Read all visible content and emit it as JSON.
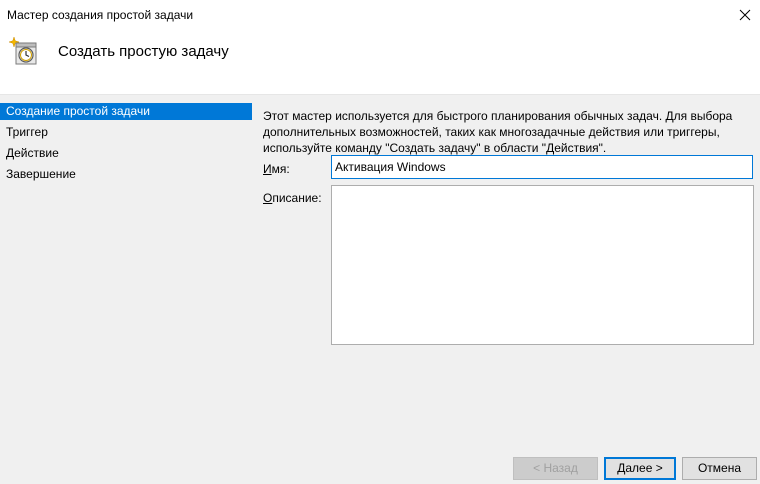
{
  "window": {
    "title": "Мастер создания простой задачи"
  },
  "header": {
    "title": "Создать простую задачу",
    "icon": "task-scheduler-clock-icon"
  },
  "nav": {
    "items": [
      {
        "label": "Создание простой задачи",
        "active": true
      },
      {
        "label": "Триггер",
        "active": false
      },
      {
        "label": "Действие",
        "active": false
      },
      {
        "label": "Завершение",
        "active": false
      }
    ]
  },
  "content": {
    "intro": "Этот мастер используется для быстрого планирования обычных задач.  Для выбора дополнительных возможностей, таких как многозадачные действия или триггеры, используйте команду \"Создать задачу\" в области \"Действия\".",
    "name_label_mnemonic": "И",
    "name_label_rest": "мя:",
    "name_value": "Активация Windows",
    "description_label_mnemonic": "О",
    "description_label_rest": "писание:",
    "description_value": ""
  },
  "buttons": {
    "back": "< Назад",
    "next": "Далее >",
    "cancel": "Отмена"
  },
  "colors": {
    "accent": "#0078d7",
    "background": "#f0f0f0"
  }
}
